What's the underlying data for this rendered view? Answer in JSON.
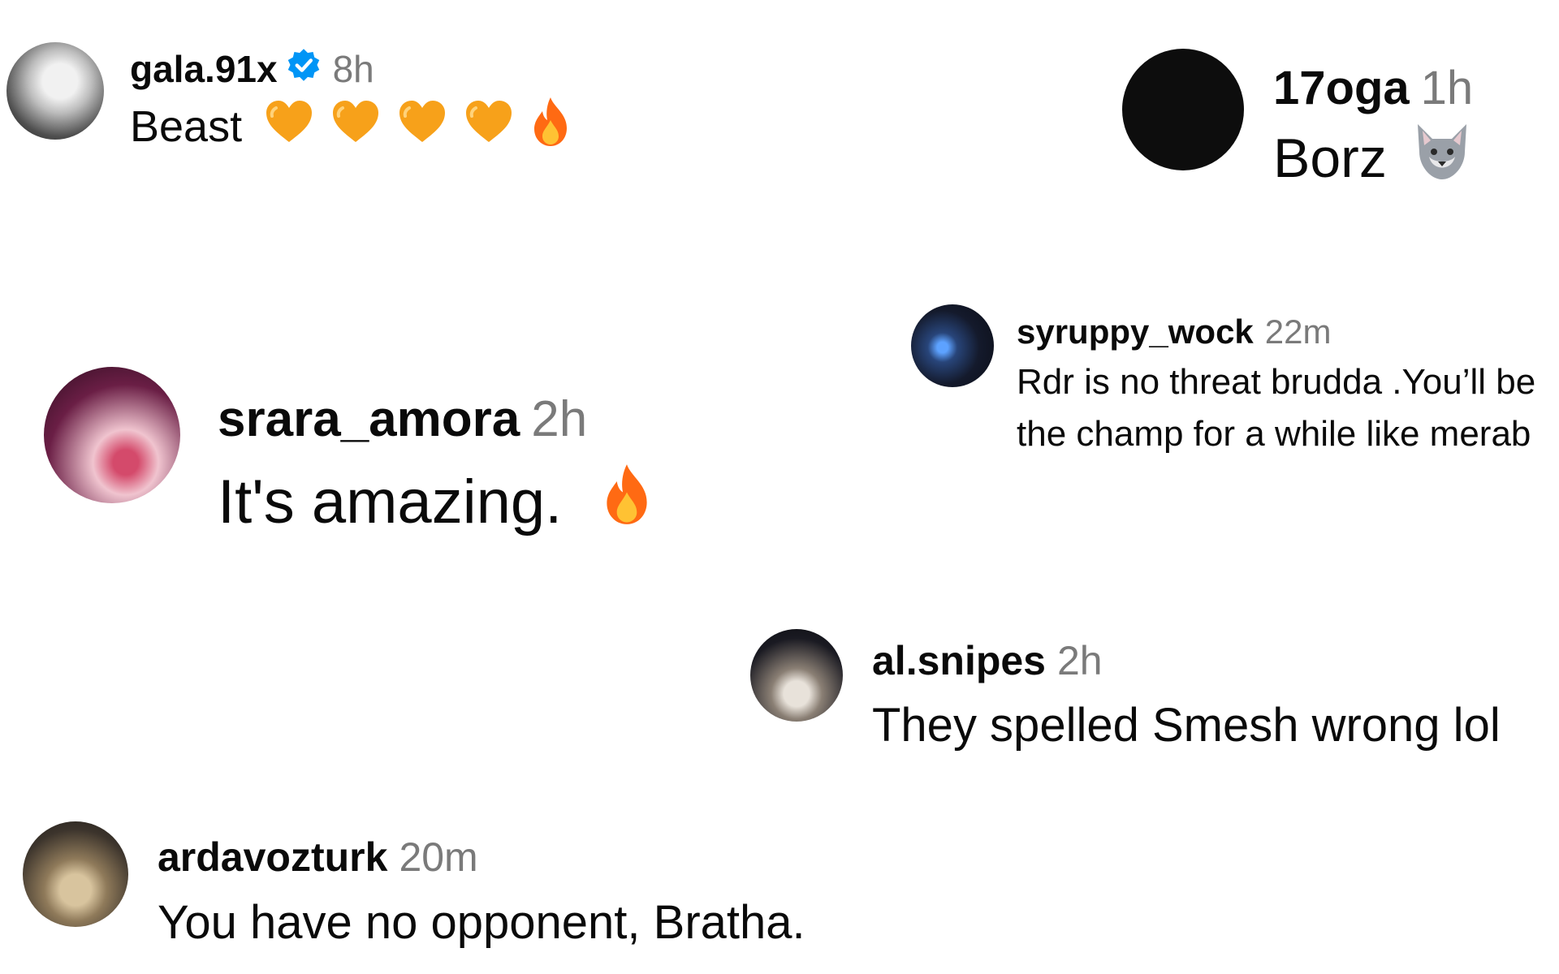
{
  "comments": [
    {
      "username": "gala.91x",
      "time": "8h",
      "verified": true,
      "text": "Beast",
      "emojis": [
        "orange-heart",
        "orange-heart",
        "orange-heart",
        "orange-heart",
        "fire"
      ]
    },
    {
      "username": "17oga",
      "time": "1h",
      "text": "Borz",
      "emojis": [
        "wolf"
      ]
    },
    {
      "username": "syruppy_wock",
      "time": "22m",
      "text": "Rdr is no threat brudda .You’ll be the champ for a while like merab"
    },
    {
      "username": "srara_amora",
      "time": "2h",
      "text": "It's amazing.",
      "emojis": [
        "fire"
      ]
    },
    {
      "username": "al.snipes",
      "time": "2h",
      "text": "They spelled Smesh wrong lol"
    },
    {
      "username": "ardavozturk",
      "time": "20m",
      "text": "You have no opponent, Bratha."
    }
  ],
  "colors": {
    "username": "#0a0a0a",
    "timestamp": "#7a7a7a",
    "verified": "#0095f6",
    "heart": "#f7a11a",
    "fire": "#ff6a13"
  }
}
